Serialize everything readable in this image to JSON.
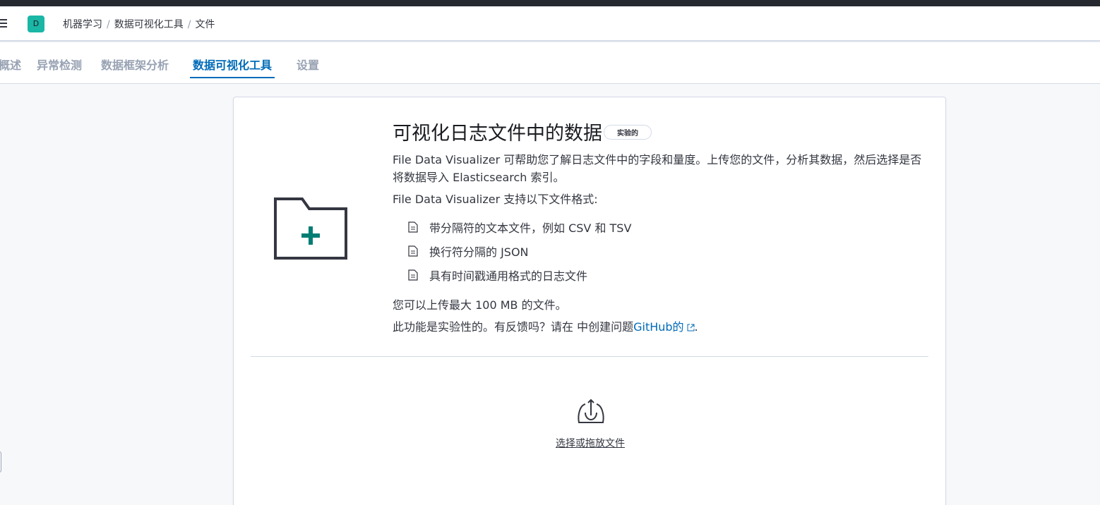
{
  "header": {
    "space_initial": "D",
    "breadcrumbs": [
      "机器学习",
      "数据可视化工具",
      "文件"
    ],
    "separator": "/"
  },
  "tabs": [
    {
      "label": "概述",
      "active": false
    },
    {
      "label": "异常检测",
      "active": false
    },
    {
      "label": "数据框架分析",
      "active": false
    },
    {
      "label": "数据可视化工具",
      "active": true
    },
    {
      "label": "设置",
      "active": false
    }
  ],
  "main": {
    "title": "可视化日志文件中的数据",
    "badge": "实验的",
    "description": "File Data Visualizer 可帮助您了解日志文件中的字段和量度。上传您的文件，分析其数据，然后选择是否将数据导入 Elasticsearch 索引。",
    "supported_intro": "File Data Visualizer 支持以下文件格式:",
    "formats": [
      "带分隔符的文本文件，例如 CSV 和 TSV",
      "换行符分隔的 JSON",
      "具有时间戳通用格式的日志文件"
    ],
    "size_note": "您可以上传最大 100 MB 的文件。",
    "feedback_prefix": "此功能是实验性的。有反馈吗？请在 中创建问题",
    "feedback_link": "GitHub的",
    "feedback_suffix": ".",
    "upload_label": "选择或拖放文件"
  },
  "colors": {
    "accent": "#006bb8",
    "avatar": "#1ab6a6",
    "folder_plus": "#017d73"
  },
  "icons": [
    "menu-icon",
    "folder-add-icon",
    "document-icon",
    "external-link-icon",
    "upload-icon"
  ]
}
